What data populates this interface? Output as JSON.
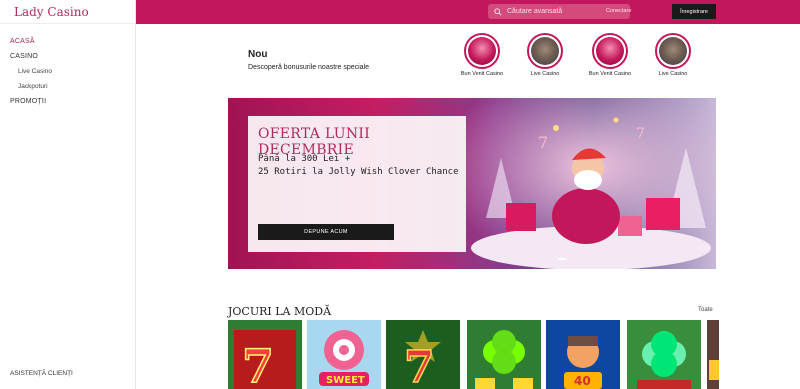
{
  "brand": {
    "name": "Lady Casino"
  },
  "sidebar": {
    "items": [
      {
        "label": "ACASĂ"
      },
      {
        "label": "CASINO"
      },
      {
        "label": "Live Casino"
      },
      {
        "label": "Jackpoturi"
      },
      {
        "label": "PROMOȚII"
      }
    ],
    "support": "ASISTENȚĂ CLIENȚI"
  },
  "header": {
    "search_placeholder": "Căutare avansată",
    "login_label": "Conectare",
    "register_label": "Înregistrare"
  },
  "promo": {
    "title": "Nou",
    "subtitle": "Descoperă bonusurile noastre speciale",
    "stories": [
      {
        "label": "Bun Venit Casino",
        "icon": "gift-story-icon"
      },
      {
        "label": "Live Casino",
        "icon": "live-table-story-icon"
      },
      {
        "label": "Bun Venit Casino",
        "icon": "gift-story-icon"
      },
      {
        "label": "Live Casino",
        "icon": "live-table-story-icon"
      }
    ]
  },
  "banner": {
    "title": "OFERTA LUNII DECEMBRIE",
    "line1": "Până la 300 Lei +",
    "line2": "25 Rotiri la Jolly Wish Clover Chance",
    "cta": "DEPUNE ACUM"
  },
  "games": {
    "title": "JOCURI LA MODĂ",
    "all_label": "Toate",
    "tiles": [
      {
        "icon": "red-seven-slot-icon"
      },
      {
        "icon": "sweet-candy-slot-icon"
      },
      {
        "icon": "green-seven-slot-icon"
      },
      {
        "icon": "clover-slot-icon"
      },
      {
        "icon": "bell-link-slot-icon"
      },
      {
        "icon": "clover-pot-slot-icon"
      },
      {
        "icon": "partial-slot-icon"
      }
    ]
  },
  "colors": {
    "brand": "#c2185b",
    "accent_text": "#b02a5e",
    "dark": "#1a1a1a"
  }
}
